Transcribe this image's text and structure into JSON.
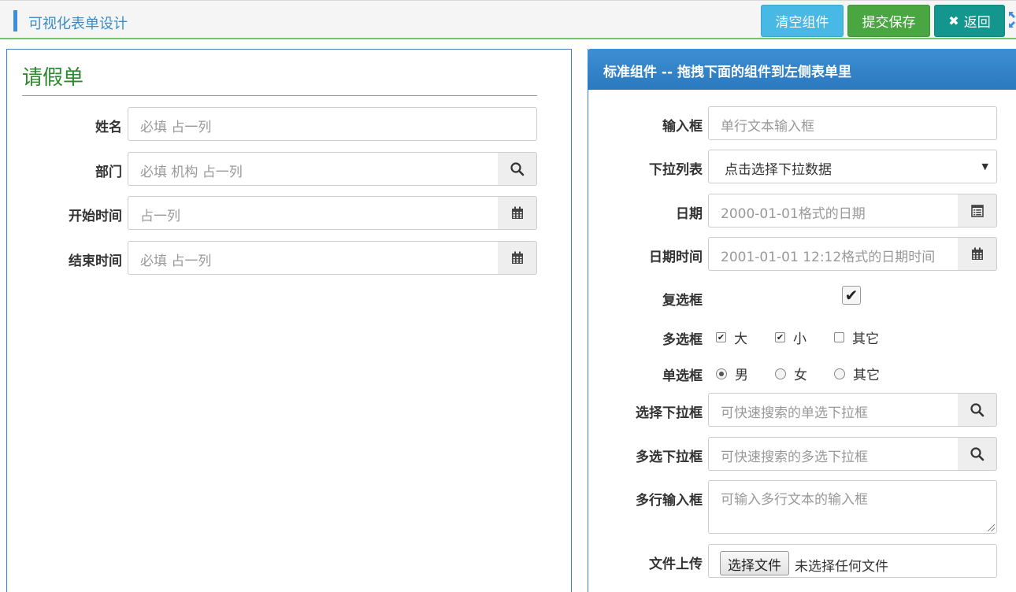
{
  "header": {
    "title": "可视化表单设计",
    "buttons": {
      "clear": "清空组件",
      "save": "提交保存",
      "back": "返回",
      "back_icon": "✖"
    },
    "accent_color": "#3c8dde",
    "border_color": "#7ac16a"
  },
  "form": {
    "title": "请假单",
    "fields": [
      {
        "label": "姓名",
        "placeholder": "必填 占一列"
      },
      {
        "label": "部门",
        "placeholder": "必填 机构 占一列",
        "icon": "search-icon"
      },
      {
        "label": "开始时间",
        "placeholder": "占一列",
        "icon": "calendar-icon"
      },
      {
        "label": "结束时间",
        "placeholder": "必填 占一列",
        "icon": "calendar-icon"
      }
    ]
  },
  "components": {
    "header": "标准组件 -- 拖拽下面的组件到左侧表单里",
    "header_color": "#2b79bf",
    "text_input": {
      "label": "输入框",
      "placeholder": "单行文本输入框"
    },
    "select": {
      "label": "下拉列表",
      "value": "点击选择下拉数据"
    },
    "date": {
      "label": "日期",
      "placeholder": "2000-01-01格式的日期",
      "icon": "calendar-list-icon"
    },
    "datetime": {
      "label": "日期时间",
      "placeholder": "2001-01-01 12:12格式的日期时间",
      "icon": "calendar-icon"
    },
    "checkbox": {
      "label": "复选框",
      "checked": true
    },
    "multi_check": {
      "label": "多选框",
      "options": [
        {
          "text": "大",
          "checked": true
        },
        {
          "text": "小",
          "checked": true
        },
        {
          "text": "其它",
          "checked": false
        }
      ]
    },
    "radio": {
      "label": "单选框",
      "options": [
        {
          "text": "男",
          "checked": true
        },
        {
          "text": "女",
          "checked": false
        },
        {
          "text": "其它",
          "checked": false
        }
      ]
    },
    "search_select": {
      "label": "选择下拉框",
      "placeholder": "可快速搜索的单选下拉框",
      "icon": "search-icon"
    },
    "search_multi": {
      "label": "多选下拉框",
      "placeholder": "可快速搜索的多选下拉框",
      "icon": "search-icon"
    },
    "textarea": {
      "label": "多行输入框",
      "placeholder": "可输入多行文本的输入框"
    },
    "file": {
      "label": "文件上传",
      "button": "选择文件",
      "status": "未选择任何文件"
    }
  }
}
